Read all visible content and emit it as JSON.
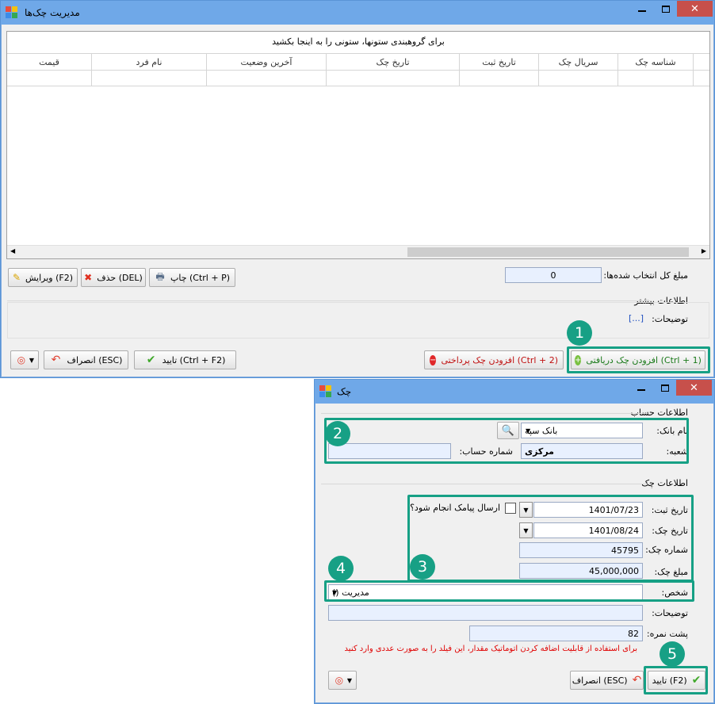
{
  "main_window": {
    "title": "مدیریت چک‌ها",
    "close_glyph": "✕",
    "group_hint": "برای گروهبندی ستونها، ستونی را به اینجا بکشید",
    "columns": [
      "شناسه چک",
      "سریال چک",
      "تاریخ ثبت",
      "تاریخ چک",
      "آخرین وضعیت",
      "نام فرد",
      "قیمت"
    ],
    "total_label": "مبلغ کل انتخاب شده‌ها:",
    "total_value": "0",
    "print_label": "چاپ (Ctrl + P)",
    "delete_label": "حذف (DEL)",
    "edit_label": "ویرایش (F2)",
    "more_info_title": "اطلاعات بیشتر",
    "description_label": "توضیحات:",
    "description_value": "[...]",
    "add_received_label": "افزودن چک دریافتی (Ctrl + 1)",
    "add_paid_label": "افزودن چک پرداختی (Ctrl + 2)",
    "confirm_label": "تایید (Ctrl + F2)",
    "cancel_label": "انصراف (ESC)"
  },
  "cheque_window": {
    "title": "چک",
    "close_glyph": "✕",
    "account_group": "اطلاعات حساب",
    "bank_label": "نام بانک:",
    "bank_value": "بانک سپه",
    "branch_label": "شعبه:",
    "branch_value": "مرکزی",
    "account_no_label": "شماره حساب:",
    "account_no_value": "",
    "cheque_group": "اطلاعات چک",
    "reg_date_label": "تاریخ ثبت:",
    "reg_date_value": "1401/07/23",
    "sms_label": "ارسال پیامک انجام شود؟",
    "cheque_date_label": "تاریخ چک:",
    "cheque_date_value": "1401/08/24",
    "cheque_no_label": "شماره چک:",
    "cheque_no_value": "45795",
    "amount_label": "مبلغ چک:",
    "amount_value": "45,000,000",
    "person_label": "شخص:",
    "person_value": "مدیریت ()",
    "desc_label": "توضیحات:",
    "desc_value": "",
    "back_no_label": "پشت نمره:",
    "back_no_value": "82",
    "hint_text": "برای استفاده از قابلیت اضافه کردن اتوماتیک مقدار، این فیلد را به صورت عددی وارد کنید",
    "confirm_label": "تایید (F2)",
    "cancel_label": "انصراف (ESC)"
  },
  "badges": [
    "1",
    "2",
    "3",
    "4",
    "5"
  ],
  "colors": {
    "highlight": "#16a085",
    "titlebar": "#6fa8e8",
    "close": "#c7504b",
    "hint_red": "#e00000"
  }
}
